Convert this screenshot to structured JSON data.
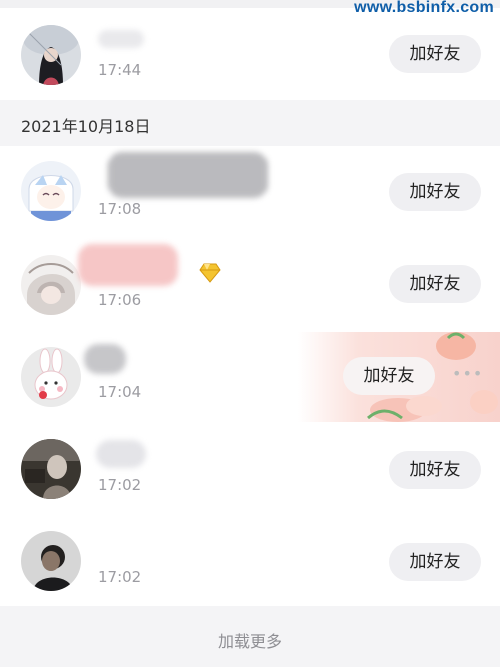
{
  "watermark": "www.bsbinfx.com",
  "section_date": "2021年10月18日",
  "add_label": "加好友",
  "load_more": "加载更多",
  "contacts": [
    {
      "time": "17:44"
    },
    {
      "time": "17:08"
    },
    {
      "time": "17:06"
    },
    {
      "time": "17:04"
    },
    {
      "time": "17:02"
    },
    {
      "time": "17:02"
    }
  ],
  "colors": {
    "button_bg": "#efeff2",
    "section_bg": "#f4f4f6",
    "time_text": "#9c9ca2",
    "watermark": "#0f5ea8"
  },
  "icons": [
    "diamond-badge-icon",
    "more-dots-icon"
  ]
}
